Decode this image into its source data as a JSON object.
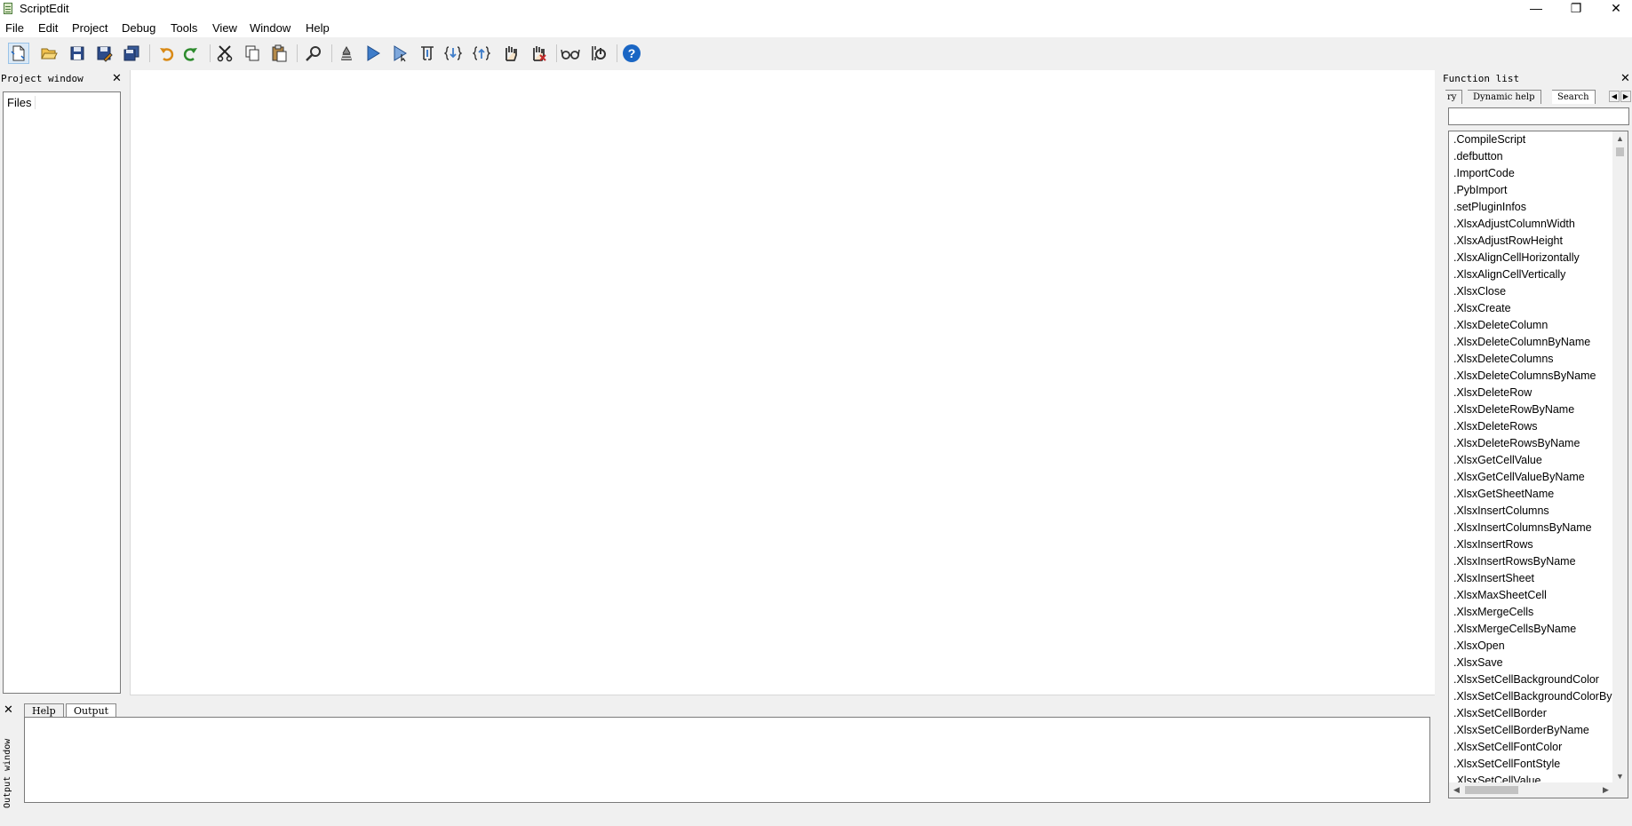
{
  "window": {
    "title": "ScriptEdit",
    "min_glyph": "—",
    "max_glyph": "❐",
    "close_glyph": "✕"
  },
  "menu": [
    "File",
    "Edit",
    "Project",
    "Debug",
    "Tools",
    "View",
    "Window",
    "Help"
  ],
  "toolbar": {
    "tools": [
      "new-file",
      "open-folder",
      "save",
      "save-as",
      "save-all",
      "undo",
      "redo",
      "cut",
      "copy",
      "paste",
      "find",
      "compile",
      "run",
      "run-to-cursor",
      "step-over",
      "step-into",
      "step-out",
      "breakpoint",
      "clear-breakpoints",
      "watch",
      "debug-settings",
      "help"
    ]
  },
  "project_window": {
    "title": "Project window",
    "close": "✕",
    "tab": "Files"
  },
  "function_list": {
    "title": "Function list",
    "close": "✕",
    "tabs": [
      "ry",
      "Dynamic help",
      "Search"
    ],
    "selected_tab": "Search",
    "search_value": "",
    "items": [
      ".CompileScript",
      ".defbutton",
      ".ImportCode",
      ".PybImport",
      ".setPluginInfos",
      ".XlsxAdjustColumnWidth",
      ".XlsxAdjustRowHeight",
      ".XlsxAlignCellHorizontally",
      ".XlsxAlignCellVertically",
      ".XlsxClose",
      ".XlsxCreate",
      ".XlsxDeleteColumn",
      ".XlsxDeleteColumnByName",
      ".XlsxDeleteColumns",
      ".XlsxDeleteColumnsByName",
      ".XlsxDeleteRow",
      ".XlsxDeleteRowByName",
      ".XlsxDeleteRows",
      ".XlsxDeleteRowsByName",
      ".XlsxGetCellValue",
      ".XlsxGetCellValueByName",
      ".XlsxGetSheetName",
      ".XlsxInsertColumns",
      ".XlsxInsertColumnsByName",
      ".XlsxInsertRows",
      ".XlsxInsertRowsByName",
      ".XlsxInsertSheet",
      ".XlsxMaxSheetCell",
      ".XlsxMergeCells",
      ".XlsxMergeCellsByName",
      ".XlsxOpen",
      ".XlsxSave",
      ".XlsxSetCellBackgroundColor",
      ".XlsxSetCellBackgroundColorBy",
      ".XlsxSetCellBorder",
      ".XlsxSetCellBorderByName",
      ".XlsxSetCellFontColor",
      ".XlsxSetCellFontStyle",
      ".XlsxSetCellValue"
    ]
  },
  "output_window": {
    "title": "Output window",
    "close": "✕",
    "tabs": [
      "Help",
      "Output"
    ],
    "selected_tab": "Output"
  },
  "colors": {
    "accent_blue": "#3e7cc9",
    "help_blue": "#1a66c4",
    "green": "#2e8b2e",
    "orange": "#d98a16"
  }
}
